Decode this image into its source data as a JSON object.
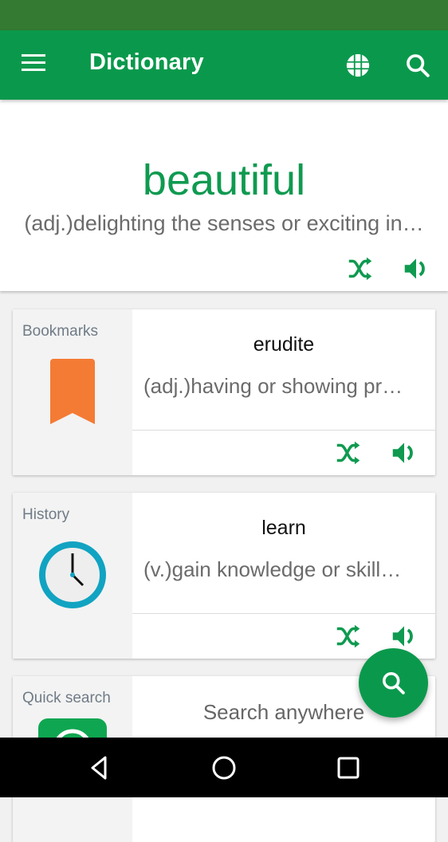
{
  "app_bar": {
    "title": "Dictionary",
    "icons": [
      "menu-icon",
      "globe-icon",
      "search-icon"
    ]
  },
  "word_of_the_day": {
    "word": "beautiful",
    "definition": "(adj.)delighting the senses or exciting in…",
    "actions": [
      "shuffle-icon",
      "speaker-icon"
    ]
  },
  "cards": [
    {
      "label": "Bookmarks",
      "icon": "bookmark-icon",
      "word": "erudite",
      "definition": "(adj.)having or showing pr…",
      "actions": [
        "shuffle-icon",
        "speaker-icon"
      ]
    },
    {
      "label": "History",
      "icon": "clock-icon",
      "word": "learn",
      "definition": "(v.)gain knowledge or skill…",
      "actions": [
        "shuffle-icon",
        "speaker-icon"
      ]
    },
    {
      "label": "Quick search",
      "icon": "quick-search-icon",
      "search_prompt": "Search anywhere"
    }
  ],
  "fab": {
    "icon": "search-icon"
  },
  "nav_bar": {
    "buttons": [
      "back",
      "home",
      "recents"
    ]
  },
  "colors": {
    "primary": "#0a994c",
    "status_bar": "#357a32",
    "accent_green": "#0f9a50",
    "bookmark_orange": "#f47b34",
    "clock_teal": "#11a3c2"
  }
}
